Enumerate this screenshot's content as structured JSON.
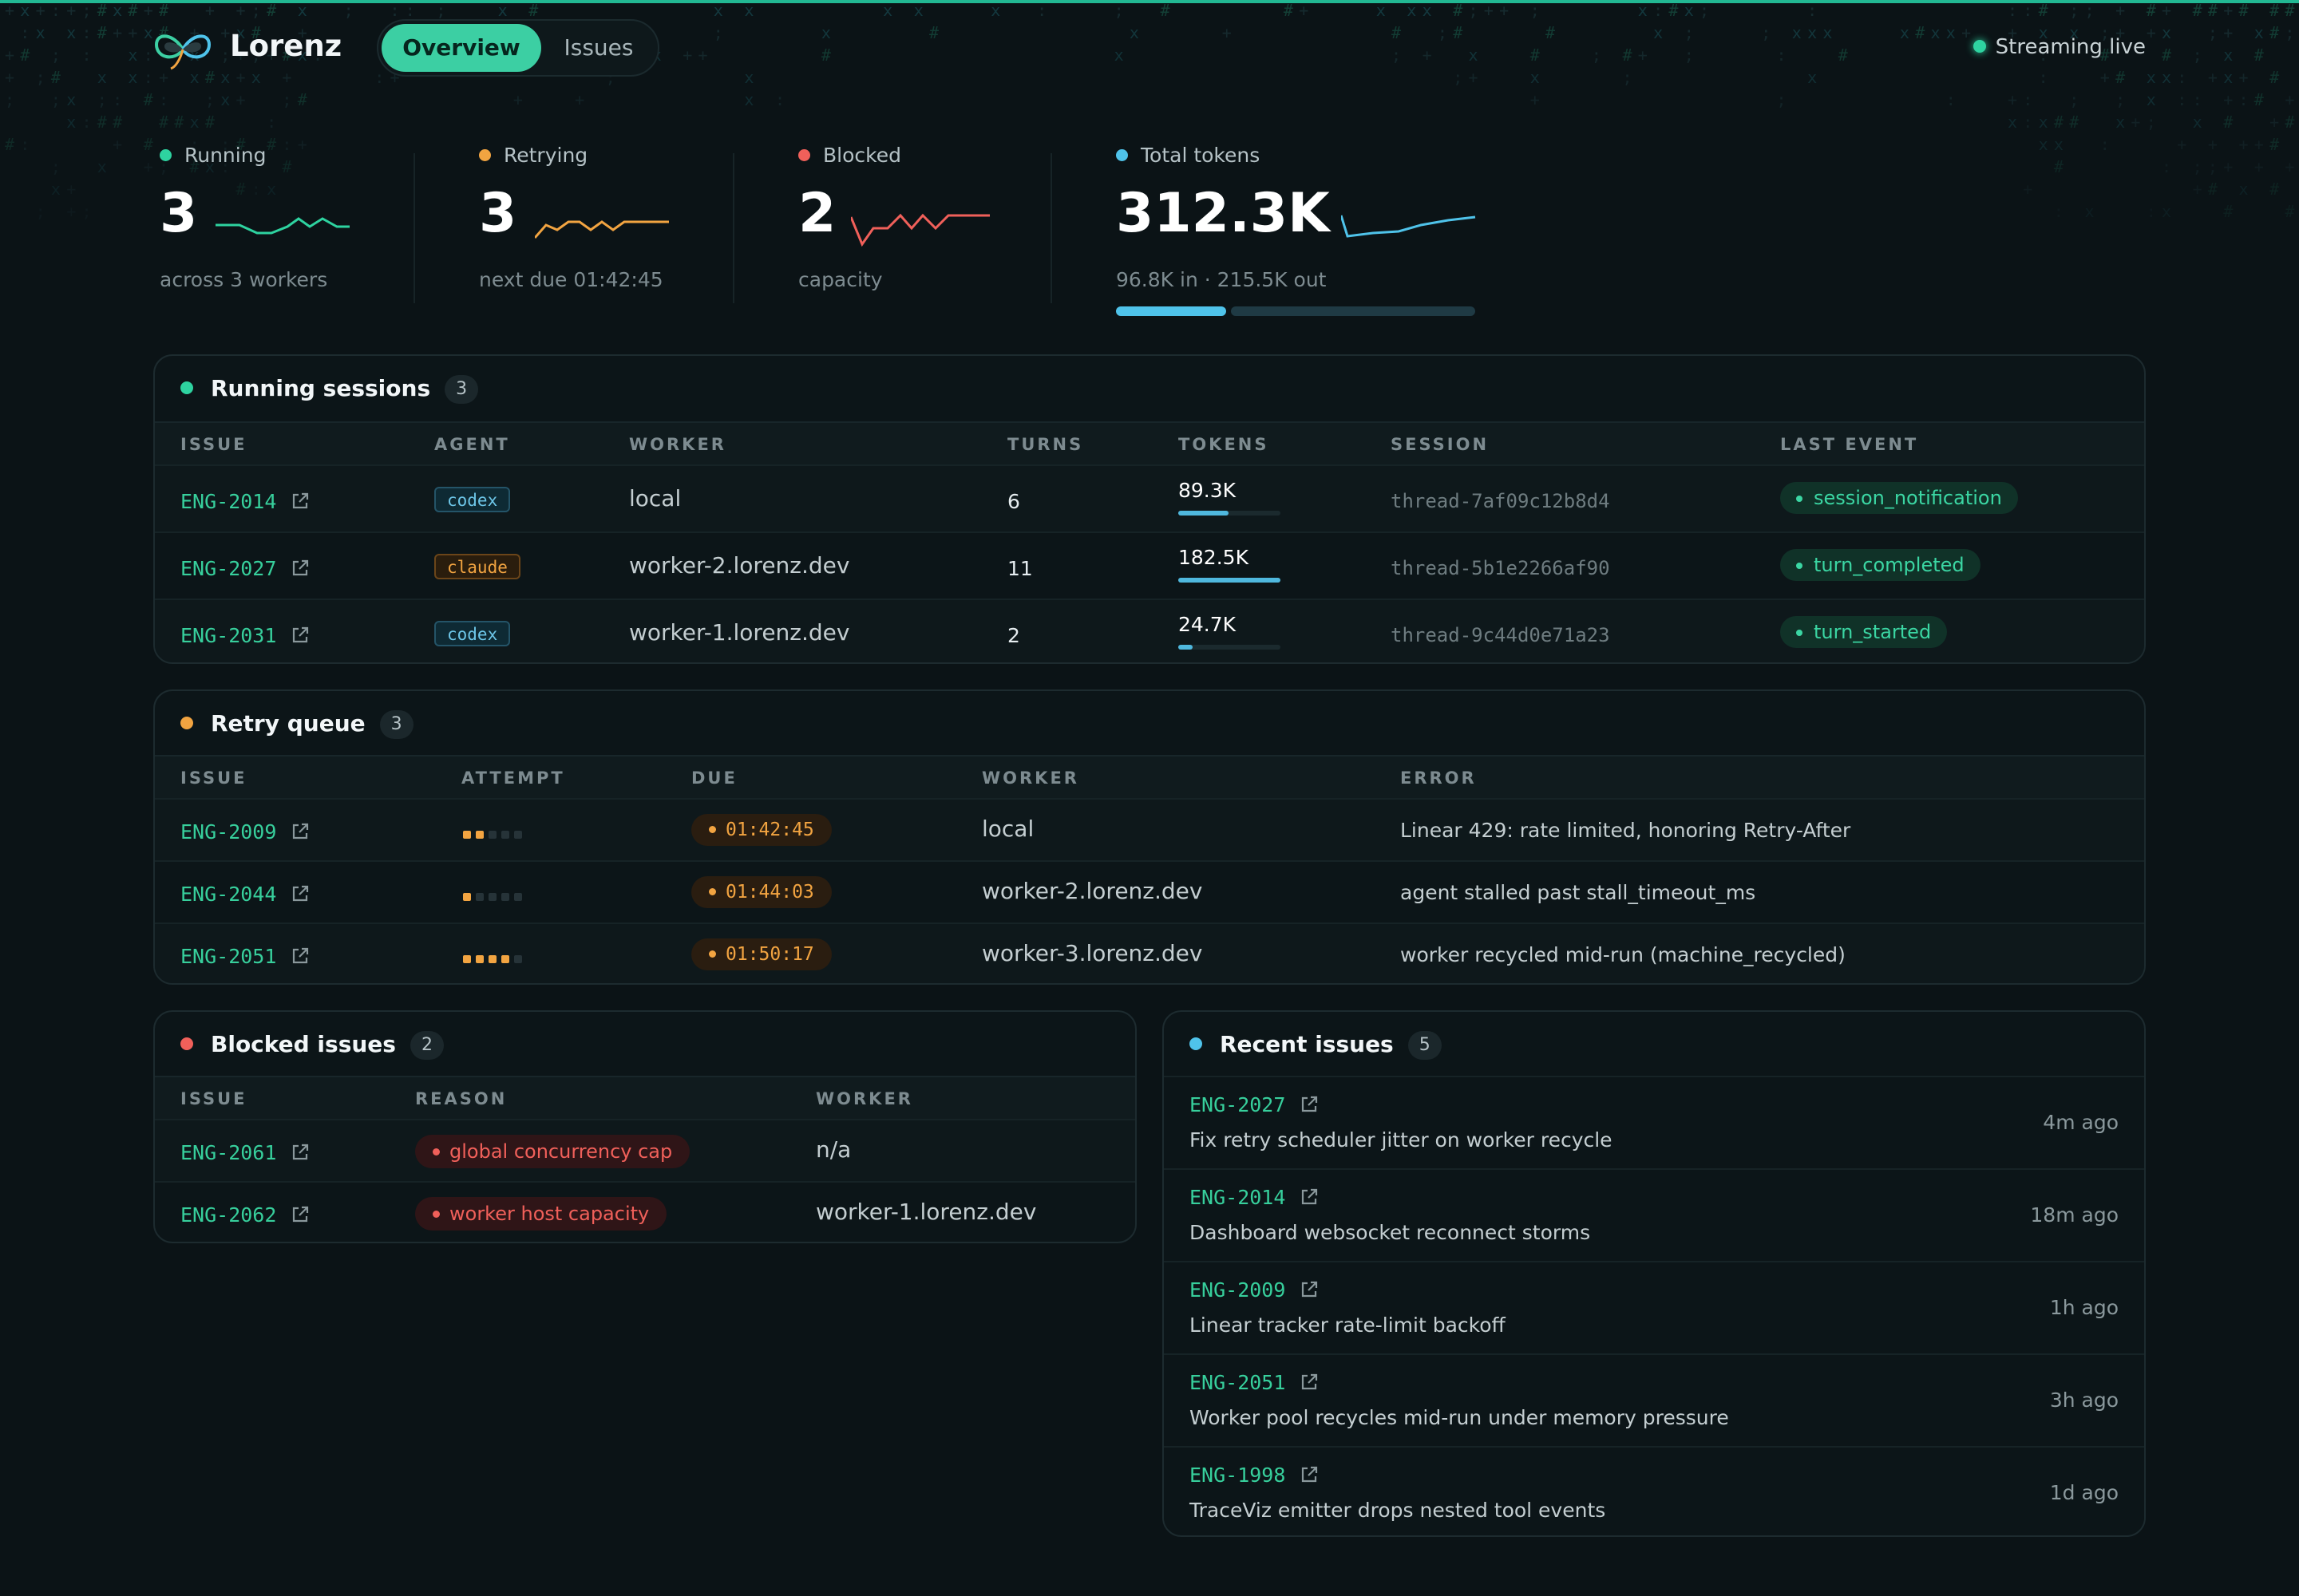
{
  "app": {
    "name": "Lorenz",
    "status": "Streaming live"
  },
  "nav": {
    "tabs": [
      {
        "label": "Overview",
        "active": true
      },
      {
        "label": "Issues",
        "active": false
      }
    ]
  },
  "colors": {
    "accent": "#3ccfa3",
    "running": "#2ed3a0",
    "retrying": "#f2a441",
    "blocked": "#f0605a",
    "tokens": "#4fc3ea"
  },
  "stats": {
    "running": {
      "label": "Running",
      "value": "3",
      "sub": "across 3 workers"
    },
    "retrying": {
      "label": "Retrying",
      "value": "3",
      "sub": "next due 01:42:45"
    },
    "blocked": {
      "label": "Blocked",
      "value": "2",
      "sub": "capacity"
    },
    "tokens": {
      "label": "Total tokens",
      "value": "312.3K",
      "sub": "96.8K in · 215.5K out",
      "in_fraction": 0.31
    }
  },
  "running_sessions": {
    "title": "Running sessions",
    "count": "3",
    "columns": [
      "ISSUE",
      "AGENT",
      "WORKER",
      "TURNS",
      "TOKENS",
      "SESSION",
      "LAST EVENT"
    ],
    "rows": [
      {
        "issue": "ENG-2014",
        "agent": "codex",
        "worker": "local",
        "turns": "6",
        "tokens": "89.3K",
        "token_fraction": 0.49,
        "session": "thread-7af09c12b8d4",
        "event": "session_notification"
      },
      {
        "issue": "ENG-2027",
        "agent": "claude",
        "worker": "worker-2.lorenz.dev",
        "turns": "11",
        "tokens": "182.5K",
        "token_fraction": 1.0,
        "session": "thread-5b1e2266af90",
        "event": "turn_completed"
      },
      {
        "issue": "ENG-2031",
        "agent": "codex",
        "worker": "worker-1.lorenz.dev",
        "turns": "2",
        "tokens": "24.7K",
        "token_fraction": 0.14,
        "session": "thread-9c44d0e71a23",
        "event": "turn_started"
      }
    ]
  },
  "retry_queue": {
    "title": "Retry queue",
    "count": "3",
    "columns": [
      "ISSUE",
      "ATTEMPT",
      "DUE",
      "WORKER",
      "ERROR"
    ],
    "rows": [
      {
        "issue": "ENG-2009",
        "attempt": 2,
        "max_attempts": 5,
        "due": "01:42:45",
        "worker": "local",
        "error": "Linear 429: rate limited, honoring Retry-After"
      },
      {
        "issue": "ENG-2044",
        "attempt": 1,
        "max_attempts": 5,
        "due": "01:44:03",
        "worker": "worker-2.lorenz.dev",
        "error": "agent stalled past stall_timeout_ms"
      },
      {
        "issue": "ENG-2051",
        "attempt": 4,
        "max_attempts": 5,
        "due": "01:50:17",
        "worker": "worker-3.lorenz.dev",
        "error": "worker recycled mid-run (machine_recycled)"
      }
    ]
  },
  "blocked_issues": {
    "title": "Blocked issues",
    "count": "2",
    "columns": [
      "ISSUE",
      "REASON",
      "WORKER"
    ],
    "rows": [
      {
        "issue": "ENG-2061",
        "reason": "global concurrency cap",
        "worker": "n/a"
      },
      {
        "issue": "ENG-2062",
        "reason": "worker host capacity",
        "worker": "worker-1.lorenz.dev"
      }
    ]
  },
  "recent_issues": {
    "title": "Recent issues",
    "count": "5",
    "items": [
      {
        "issue": "ENG-2027",
        "title": "Fix retry scheduler jitter on worker recycle",
        "ago": "4m ago"
      },
      {
        "issue": "ENG-2014",
        "title": "Dashboard websocket reconnect storms",
        "ago": "18m ago"
      },
      {
        "issue": "ENG-2009",
        "title": "Linear tracker rate-limit backoff",
        "ago": "1h ago"
      },
      {
        "issue": "ENG-2051",
        "title": "Worker pool recycles mid-run under memory pressure",
        "ago": "3h ago"
      },
      {
        "issue": "ENG-1998",
        "title": "TraceViz emitter drops nested tool events",
        "ago": "1d ago"
      }
    ]
  }
}
